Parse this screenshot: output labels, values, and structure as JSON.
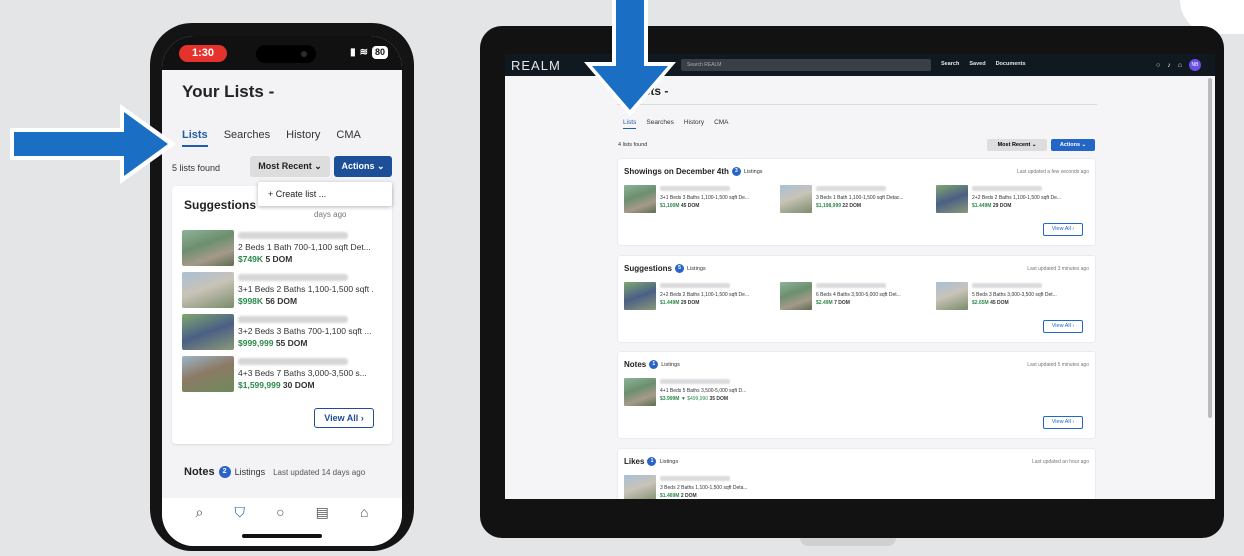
{
  "phone": {
    "status": {
      "time": "1:30",
      "battery": "80"
    },
    "title": "Your Lists -",
    "tabs": [
      {
        "label": "Lists"
      },
      {
        "label": "Searches"
      },
      {
        "label": "History"
      },
      {
        "label": "CMA"
      }
    ],
    "count": "5 lists found",
    "sort_label": "Most Recent",
    "actions_label": "Actions",
    "dropdown_item": "+ Create list ...",
    "suggestions": {
      "title": "Suggestions",
      "updated": "days ago",
      "listings": [
        {
          "specs": "2 Beds 1 Bath 700-1,100 sqft Det...",
          "price": "$749K",
          "dom": "5 DOM"
        },
        {
          "specs": "3+1 Beds 2 Baths 1,100-1,500 sqft .",
          "price": "$998K",
          "dom": "56 DOM"
        },
        {
          "specs": "3+2 Beds 3 Baths 700-1,100 sqft ...",
          "price": "$999,999",
          "dom": "55 DOM"
        },
        {
          "specs": "4+3 Beds 7 Baths 3,000-3,500 s...",
          "price": "$1,599,999",
          "dom": "30 DOM"
        }
      ],
      "view_all": "View All"
    },
    "notes": {
      "title": "Notes",
      "badge": "2",
      "label": "Listings",
      "updated": "Last updated 14 days ago"
    },
    "bottom_nav": [
      {
        "icon": "search-icon",
        "glyph": "⌕"
      },
      {
        "icon": "bookmark-icon",
        "glyph": "⛉"
      },
      {
        "icon": "chat-icon",
        "glyph": "○"
      },
      {
        "icon": "documents-icon",
        "glyph": "▤"
      },
      {
        "icon": "home-icon",
        "glyph": "⌂"
      }
    ]
  },
  "laptop": {
    "logo": "REALM",
    "search_placeholder": "Search REALM",
    "nav_links": [
      "Search",
      "Saved",
      "Documents"
    ],
    "avatar": "NB",
    "title": "Lists -",
    "tabs": [
      {
        "label": "Lists"
      },
      {
        "label": "Searches"
      },
      {
        "label": "History"
      },
      {
        "label": "CMA"
      }
    ],
    "count": "4 lists found",
    "sort_label": "Most Recent",
    "actions_label": "Actions",
    "cards": [
      {
        "title": "Showings on December 4th",
        "badge": "3",
        "label": "Listings",
        "updated": "Last updated a few seconds ago",
        "listings": [
          {
            "specs": "3+1 Beds 3 Baths 1,100-1,500 sqft De...",
            "price": "$1,100M",
            "dom": "45 DOM"
          },
          {
            "specs": "3 Beds 1 Bath 1,100-1,500 sqft Detac...",
            "price": "$1,198,999",
            "dom": "22 DOM"
          },
          {
            "specs": "2+2 Beds 2 Baths 1,100-1,500 sqft De...",
            "price": "$1.449M",
            "dom": "29 DOM"
          }
        ],
        "view_all": "View All"
      },
      {
        "title": "Suggestions",
        "badge": "5",
        "label": "Listings",
        "updated": "Last updated 3 minutes ago",
        "listings": [
          {
            "specs": "2+2 Beds 2 Baths 1,100-1,500 sqft De...",
            "price": "$1.449M",
            "dom": "29 DOM"
          },
          {
            "specs": "6 Beds 4 Baths 3,500-5,000 sqft Det...",
            "price": "$2.49M",
            "dom": "7 DOM"
          },
          {
            "specs": "5 Beds 3 Baths 3,000-3,500 sqft Det...",
            "price": "$2.65M",
            "dom": "45 DOM"
          }
        ],
        "view_all": "View All"
      },
      {
        "title": "Notes",
        "badge": "1",
        "label": "Listings",
        "updated": "Last updated 5 minutes ago",
        "listings": [
          {
            "specs": "4+1 Beds 5 Baths 3,500-5,000 sqft D...",
            "price": "$3.999M",
            "reduced": "▼ $499,990",
            "dom": "35 DOM"
          }
        ],
        "view_all": "View All"
      },
      {
        "title": "Likes",
        "badge": "1",
        "label": "Listings",
        "updated": "Last updated an hour ago",
        "listings": [
          {
            "specs": "3 Beds 2 Baths 1,100-1,500 sqft Deta...",
            "price": "$1.469M",
            "dom": "2 DOM"
          }
        ]
      }
    ]
  },
  "colors": {
    "accent": "#1f5ea8",
    "arrow": "#1a6fc4",
    "price_green": "#2c8a4a",
    "nav_dark": "#101820"
  }
}
